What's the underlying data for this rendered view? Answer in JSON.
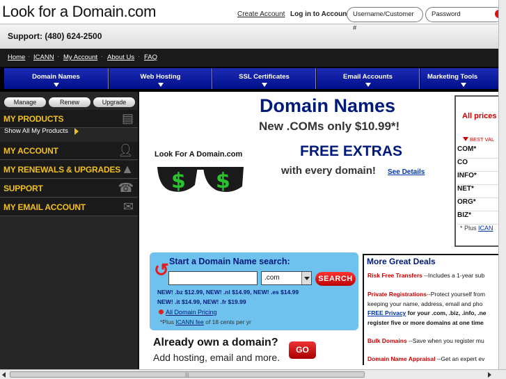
{
  "logo": "Look for a Domain.com",
  "support": "Support: (480) 624-2500",
  "account": {
    "create": "Create Account",
    "login_label": "Log in to Account:",
    "username_placeholder": "Username/Customer #",
    "password_placeholder": "Password"
  },
  "links": [
    "Home",
    "ICANN",
    "My Account",
    "About Us",
    "FAQ"
  ],
  "nav_tabs": [
    "Domain Names",
    "Web Hosting",
    "SSL Certificates",
    "Email Accounts",
    "Marketing Tools"
  ],
  "sidebar": {
    "buttons": [
      "Manage",
      "Renew",
      "Upgrade"
    ],
    "sections": [
      "MY PRODUCTS",
      "MY ACCOUNT",
      "MY RENEWALS & UPGRADES",
      "SUPPORT",
      "MY EMAIL ACCOUNT"
    ],
    "show_all": "Show All My Products"
  },
  "hero": {
    "title": "Domain Names",
    "subtitle": "New .COMs only $10.99*!",
    "brand_label": "Look For A Domain.com",
    "free_extras": "FREE EXTRAS",
    "every_domain": "with every domain!",
    "see_details": "See Details"
  },
  "prices": {
    "heading": "All prices",
    "best_value": "BEST VAL",
    "tlds": [
      "COM*",
      "CO",
      "INFO*",
      "NET*",
      "ORG*",
      "BIZ*"
    ],
    "plus": "* Plus",
    "icann": "ICAN"
  },
  "search": {
    "title": "Start a Domain Name search:",
    "input_value": "",
    "tld_selected": ".com",
    "button": "SEARCH",
    "new_line_1": "NEW! .bz $12.99, NEW! .nl $14.99, NEW! .es $14.99",
    "new_line_2": "NEW! .it $14.99, NEW! .fr $19.99",
    "all_pricing": "All Domain Pricing",
    "fee_prefix": "*Plus",
    "fee_link": "ICANN fee",
    "fee_suffix": "of 18 cents per yr"
  },
  "already": {
    "title": "Already own a domain?",
    "subtitle": "Add hosting, email and more.",
    "go": "GO"
  },
  "deals": {
    "title": "More Great Deals",
    "items": [
      {
        "head": "Risk Free Transfers",
        "text": " --Includes a 1-year sub"
      },
      {
        "head": "Private Registrations",
        "text": "--Protect yourself from"
      },
      {
        "head": "",
        "text": "keeping your name, address, email and pho"
      },
      {
        "link": "FREE Privacy",
        "text": " for your .com, .biz, .info, .ne"
      },
      {
        "head": "",
        "text": "register five or more domains at one time"
      },
      {
        "head": "Bulk Domains",
        "text": " --Save when you register mu"
      },
      {
        "head": "Domain Name Appraisal",
        "text": " --Get an expert ev"
      }
    ]
  }
}
